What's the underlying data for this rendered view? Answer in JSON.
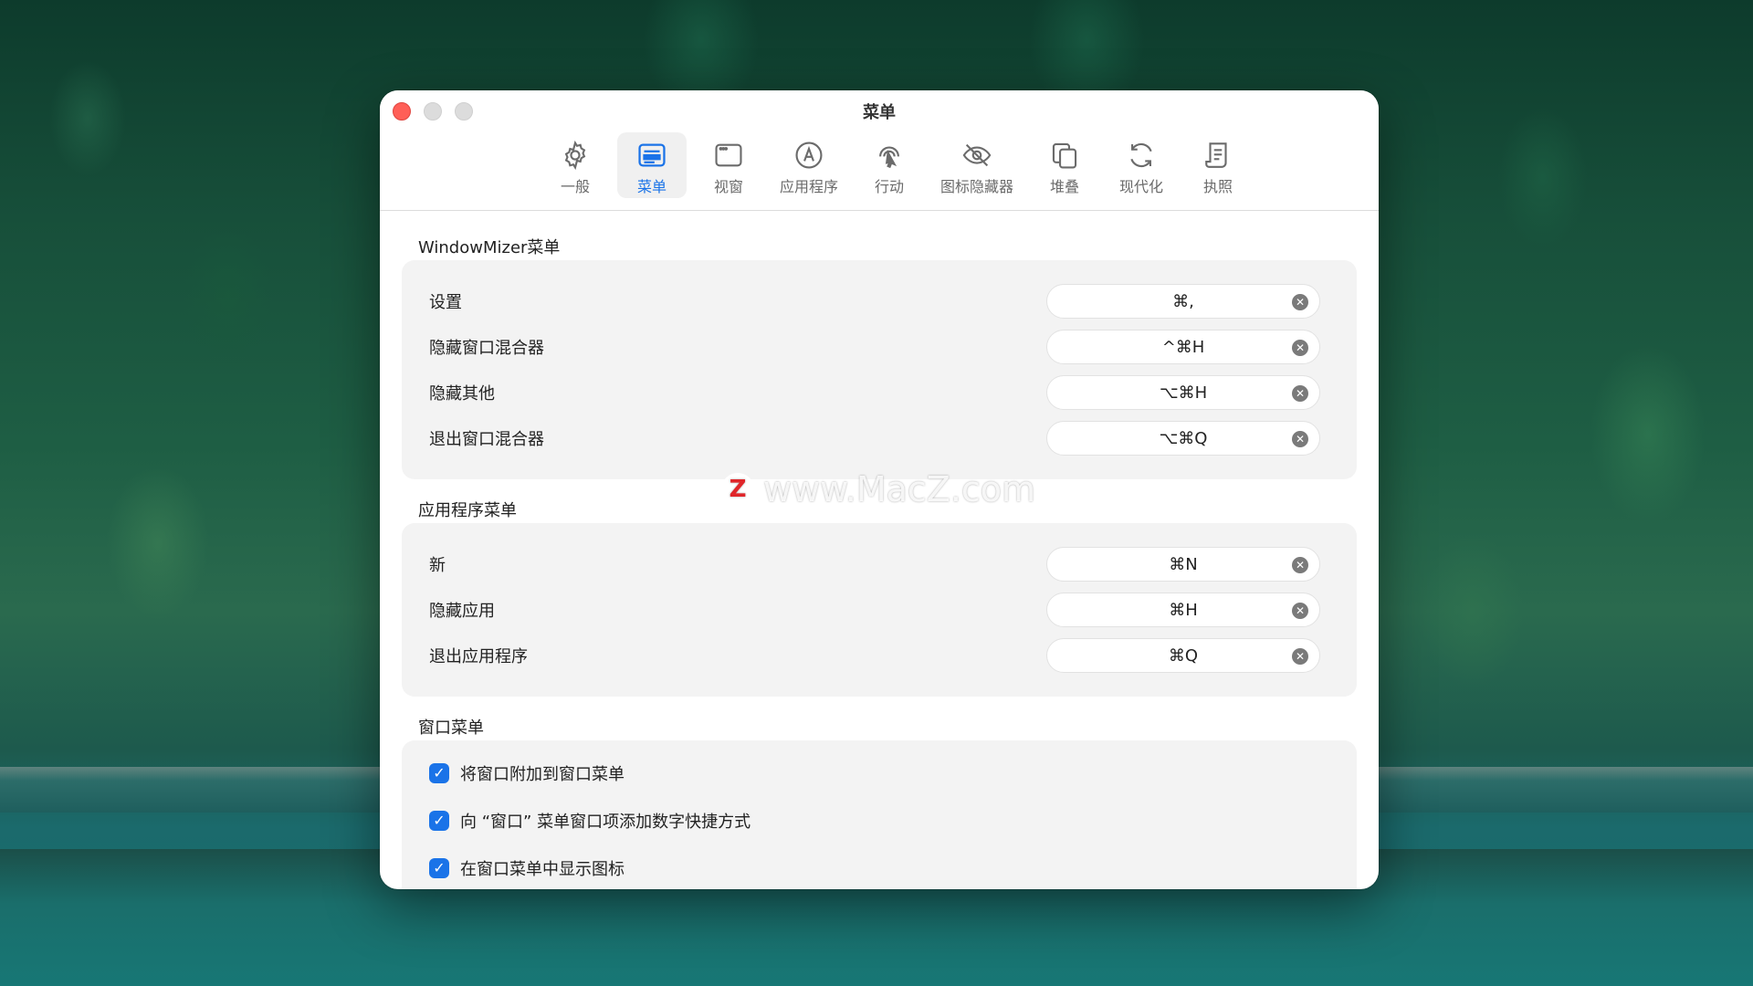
{
  "window": {
    "title": "菜单"
  },
  "toolbar": {
    "items": [
      {
        "label": "一般",
        "icon": "gear-icon",
        "active": false
      },
      {
        "label": "菜单",
        "icon": "menu-icon",
        "active": true
      },
      {
        "label": "视窗",
        "icon": "window-icon",
        "active": false
      },
      {
        "label": "应用程序",
        "icon": "app-store-icon",
        "active": false
      },
      {
        "label": "行动",
        "icon": "pointer-action-icon",
        "active": false
      },
      {
        "label": "图标隐藏器",
        "icon": "eye-slash-icon",
        "active": false
      },
      {
        "label": "堆叠",
        "icon": "stack-icon",
        "active": false
      },
      {
        "label": "现代化",
        "icon": "refresh-icon",
        "active": false
      },
      {
        "label": "执照",
        "icon": "license-icon",
        "active": false
      }
    ]
  },
  "sections": {
    "windowmizer": {
      "title": "WindowMizer菜单",
      "rows": [
        {
          "label": "设置",
          "shortcut": "⌘,"
        },
        {
          "label": "隐藏窗口混合器",
          "shortcut": "^⌘H"
        },
        {
          "label": "隐藏其他",
          "shortcut": "⌥⌘H"
        },
        {
          "label": "退出窗口混合器",
          "shortcut": "⌥⌘Q"
        }
      ]
    },
    "app": {
      "title": "应用程序菜单",
      "rows": [
        {
          "label": "新",
          "shortcut": "⌘N"
        },
        {
          "label": "隐藏应用",
          "shortcut": "⌘H"
        },
        {
          "label": "退出应用程序",
          "shortcut": "⌘Q"
        }
      ]
    },
    "window_menu": {
      "title": "窗口菜单",
      "checks": [
        {
          "label": "将窗口附加到窗口菜单",
          "checked": true
        },
        {
          "label": "向 “窗口” 菜单窗口项添加数字快捷方式",
          "checked": true
        },
        {
          "label": "在窗口菜单中显示图标",
          "checked": true
        }
      ]
    }
  },
  "watermark": {
    "logo": "Z",
    "text": "www.MacZ.com"
  },
  "colors": {
    "accent": "#1a73e8",
    "close": "#ff5f57"
  }
}
